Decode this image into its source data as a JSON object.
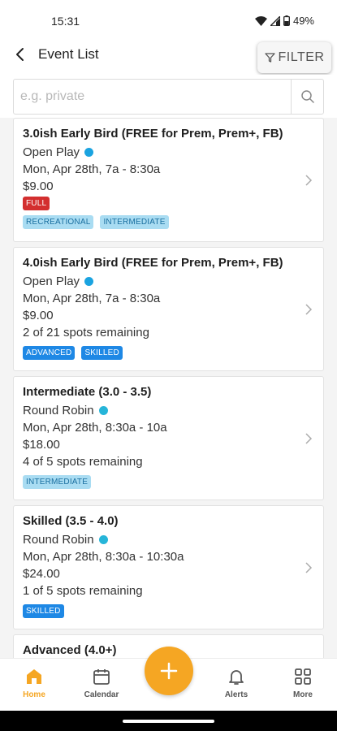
{
  "status_bar": {
    "time": "15:31",
    "battery": "49%"
  },
  "header": {
    "title": "Event List",
    "filter_label": "FILTER"
  },
  "search": {
    "placeholder": "e.g. private",
    "value": ""
  },
  "colors": {
    "accent": "#f5a623",
    "full": "#d32f2f",
    "light_tag": "#a9dcf2",
    "dark_tag": "#1e88e5",
    "dot": "#1aa3e0"
  },
  "events": [
    {
      "title": "3.0ish Early Bird (FREE for Prem, Prem+, FB)",
      "type": "Open Play",
      "datetime": "Mon, Apr 28th, 7a - 8:30a",
      "price": "$9.00",
      "full_label": "FULL",
      "tags": [
        {
          "label": "RECREATIONAL",
          "style": "light"
        },
        {
          "label": "INTERMEDIATE",
          "style": "light"
        }
      ]
    },
    {
      "title": "4.0ish Early Bird (FREE for Prem, Prem+, FB)",
      "type": "Open Play",
      "datetime": "Mon, Apr 28th, 7a - 8:30a",
      "price": "$9.00",
      "spots": "2 of 21 spots remaining",
      "tags": [
        {
          "label": "ADVANCED",
          "style": "dark"
        },
        {
          "label": "SKILLED",
          "style": "dark"
        }
      ]
    },
    {
      "title": "Intermediate (3.0 - 3.5)",
      "type": "Round Robin",
      "datetime": "Mon, Apr 28th, 8:30a - 10a",
      "price": "$18.00",
      "spots": "4 of 5 spots remaining",
      "tags": [
        {
          "label": "INTERMEDIATE",
          "style": "light"
        }
      ]
    },
    {
      "title": "Skilled (3.5 - 4.0)",
      "type": "Round Robin",
      "datetime": "Mon, Apr 28th, 8:30a - 10:30a",
      "price": "$24.00",
      "spots": "1 of 5 spots remaining",
      "tags": [
        {
          "label": "SKILLED",
          "style": "dark"
        }
      ]
    },
    {
      "title": "Advanced (4.0+)"
    }
  ],
  "nav": [
    {
      "label": "Home",
      "icon": "home-icon",
      "active": true
    },
    {
      "label": "Calendar",
      "icon": "calendar-icon",
      "active": false
    },
    {
      "label": "Alerts",
      "icon": "bell-icon",
      "active": false
    },
    {
      "label": "More",
      "icon": "grid-icon",
      "active": false
    }
  ],
  "fab": {
    "icon": "plus-icon"
  }
}
